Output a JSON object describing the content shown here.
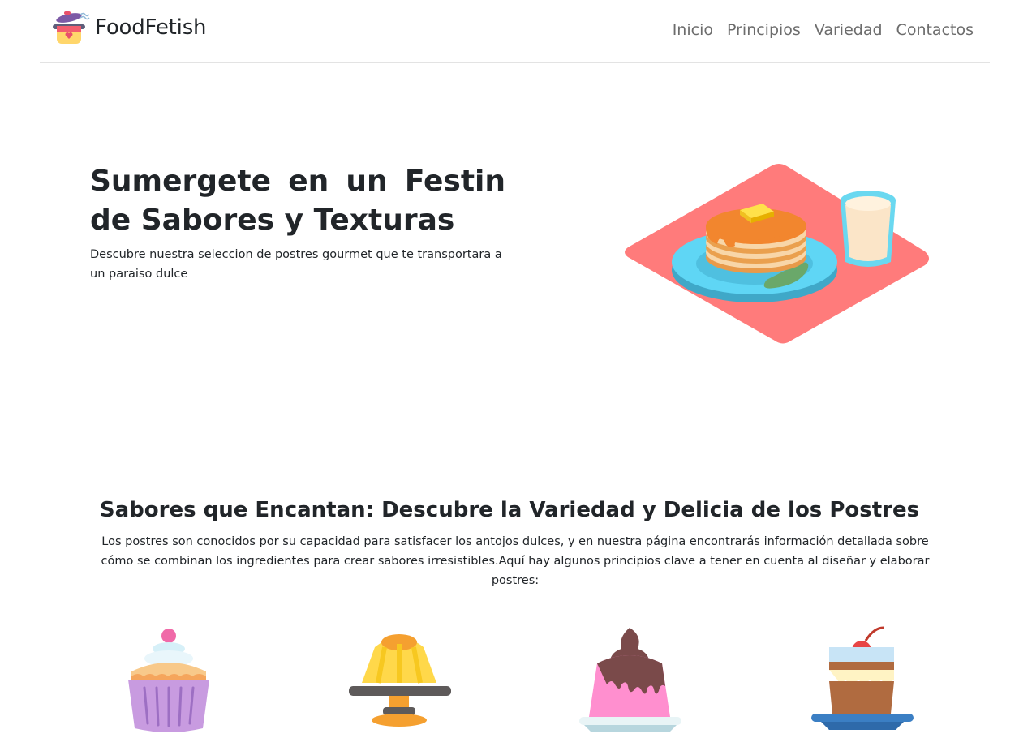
{
  "navbar": {
    "brand": "FoodFetish",
    "logo_icon": "cooking-pot-icon",
    "links": [
      "Inicio",
      "Principios",
      "Variedad",
      "Contactos"
    ]
  },
  "hero": {
    "title": "Sumergete en un Festin de Sabores y Texturas",
    "text": "Descubre nuestra seleccion de postres gourmet que te transportara a un paraiso dulce",
    "image_icon": "pancakes-milk-illustration"
  },
  "section": {
    "title": "Sabores que Encantan: Descubre la Variedad y Delicia de los Postres",
    "text": "Los postres son conocidos por su capacidad para satisfacer los antojos dulces, y en nuestra página encontrarás información detallada sobre cómo se combinan los ingredientes para crear sabores irresistibles.Aquí hay algunos principios clave a tener en cuenta al diseñar y elaborar postres:",
    "dessert_icons": [
      "cupcake-icon",
      "jelly-cake-icon",
      "pudding-icon",
      "cherry-parfait-icon"
    ]
  },
  "colors": {
    "placemat": "#ff7b7b",
    "plate": "#5fd0f0",
    "pancake": "#f7a44a",
    "text": "#212529",
    "nav_link": "#6c6c6c"
  }
}
